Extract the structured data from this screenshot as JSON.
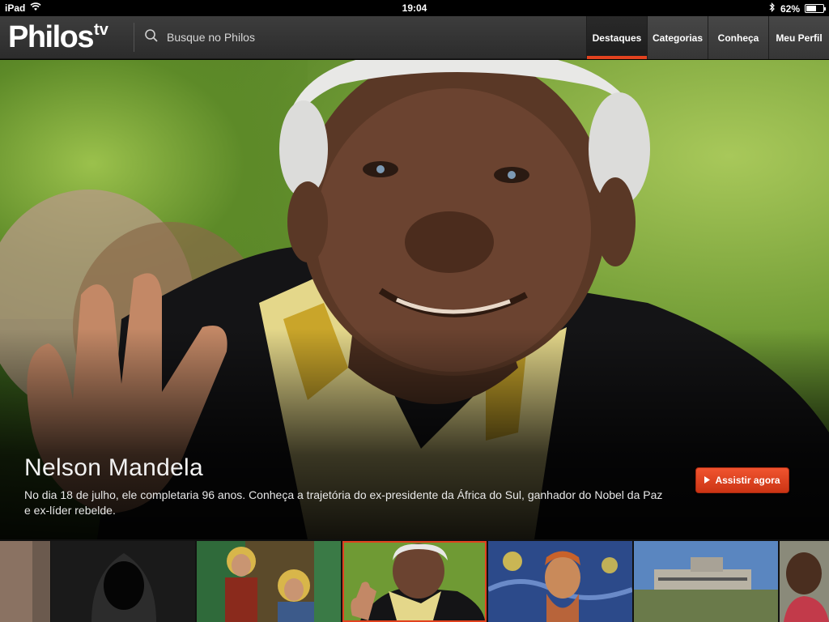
{
  "status_bar": {
    "device": "iPad",
    "time": "19:04",
    "battery": "62%",
    "battery_level": 0.62
  },
  "app": {
    "logo_main": "Philos",
    "logo_sub": "tv"
  },
  "search": {
    "placeholder": "Busque no Philos"
  },
  "tabs": [
    {
      "label": "Destaques",
      "active": true
    },
    {
      "label": "Categorias",
      "active": false
    },
    {
      "label": "Conheça",
      "active": false
    },
    {
      "label": "Meu Perfil",
      "active": false
    }
  ],
  "featured": {
    "title": "Nelson Mandela",
    "description": "No dia 18 de julho, ele completaria 96 anos. Conheça a trajetória do ex-presidente da África do Sul, ganhador do Nobel da Paz e ex-líder rebelde.",
    "cta_label": "Assistir agora"
  },
  "thumbnails": [
    {
      "subject": "partial-left",
      "selected": false
    },
    {
      "subject": "hooded-figure",
      "selected": false
    },
    {
      "subject": "stained-glass-saints",
      "selected": false
    },
    {
      "subject": "nelson-mandela",
      "selected": true
    },
    {
      "subject": "van-gogh-self-portrait",
      "selected": false
    },
    {
      "subject": "modern-building",
      "selected": false
    },
    {
      "subject": "child-portrait",
      "selected": false
    }
  ],
  "colors": {
    "accent": "#e2421f",
    "nav_bg": "#333333",
    "status_bg": "#000000"
  }
}
